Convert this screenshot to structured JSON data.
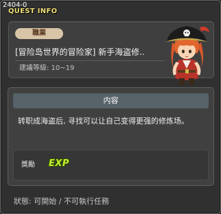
{
  "window": {
    "id": "2404-0",
    "title": "QUEST INFO"
  },
  "header": {
    "job_badge": "職業",
    "quest_name": "[冒险岛世界的冒险家] 新手海盗修..",
    "recommended_level": "建議等級: 10~19",
    "portrait_icon": "pirate-girl-portrait"
  },
  "content": {
    "section_title": "内容",
    "description": "转职成海盗后, 寻找可以让自己变得更强的修炼场。",
    "reward_label": "獎勵",
    "reward_icon_text": "EXP"
  },
  "status": "狀態: 可開始 / 不可執行任務",
  "colors": {
    "title": "#f3e27a",
    "badge_bg": "#d8c5a8",
    "content_header_bg": "#576269",
    "exp": "#c7ef30"
  }
}
